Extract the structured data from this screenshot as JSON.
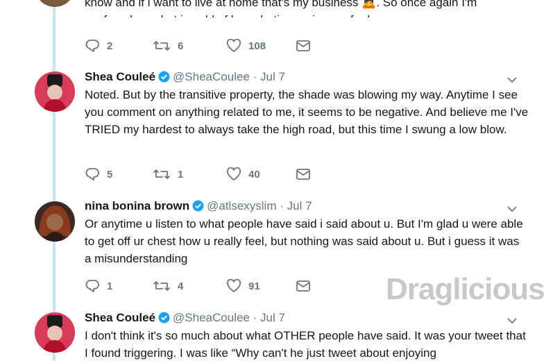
{
  "tweets": [
    {
      "text_line1": "know and if i want to live at home that's my business 🙇. So once again I'm",
      "text_line2": "confused on what i could of been hating on i came for lee",
      "replies": "2",
      "retweets": "6",
      "likes": "108"
    },
    {
      "name": "Shea Couleé",
      "handle": "@SheaCoulee",
      "dot": "·",
      "date": "Jul 7",
      "text": "Noted. But by the transitive property, the shade was blowing my way. Anytime I see you comment on anything related to me, it seems to be negative. And believe me I've TRIED my hardest to always take the high road, but this time I swung a low blow.",
      "replies": "5",
      "retweets": "1",
      "likes": "40"
    },
    {
      "name": "nina bonina brown",
      "handle": "@atlsexyslim",
      "dot": "·",
      "date": "Jul 7",
      "text": "Or anytime u listen to what people have said i said about u. But I'm glad u were able to get off ur chest how u really feel, but nothing was said about u. But i guess it was a misunderstanding",
      "replies": "1",
      "retweets": "4",
      "likes": "91"
    },
    {
      "name": "Shea Couleé",
      "handle": "@SheaCoulee",
      "dot": "·",
      "date": "Jul 7",
      "text": "I don't think it's so much about what OTHER people have said. It was your tweet that I found triggering. I was like “Why can't he just tweet about enjoying"
    }
  ],
  "watermark": "Draglicious",
  "colors": {
    "verified": "#1da1f2",
    "icon": "#657786",
    "thread": "#c4e4f6"
  },
  "icons": [
    "reply-icon",
    "retweet-icon",
    "like-icon",
    "message-icon",
    "verified-icon",
    "caret-down-icon"
  ]
}
